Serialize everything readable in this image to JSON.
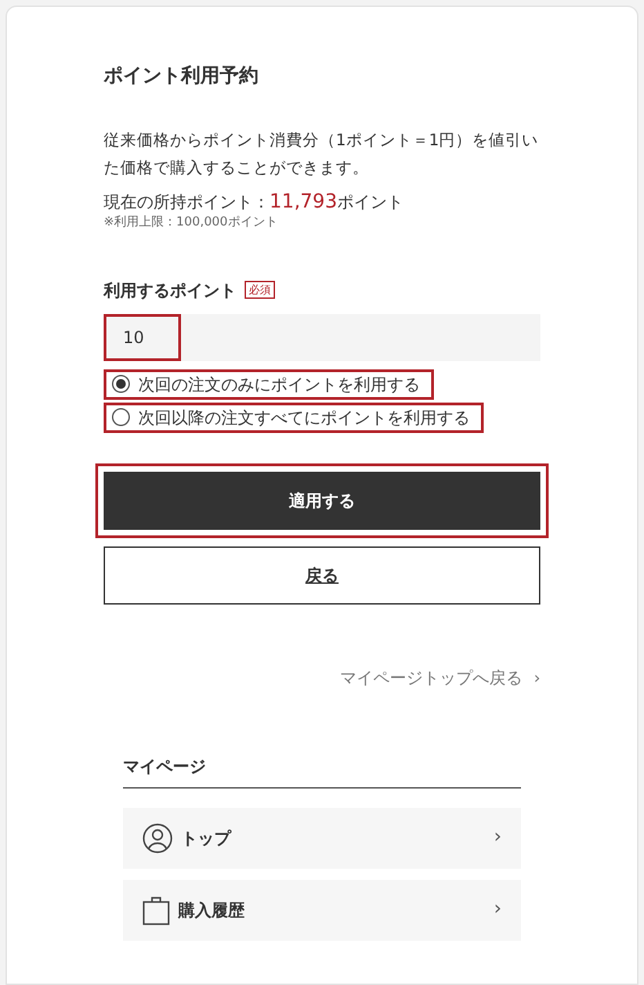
{
  "title": "ポイント利用予約",
  "description": "従来価格からポイント消費分（1ポイント＝1円）を値引いた価格で購入することができます。",
  "current_points": {
    "label": "現在の所持ポイント：",
    "value": "11,793",
    "unit": "ポイント"
  },
  "limit_note": "※利用上限：100,000ポイント",
  "points_field": {
    "label": "利用するポイント",
    "required_badge": "必須",
    "value": "10",
    "highlighted": true
  },
  "options": [
    {
      "label": "次回の注文のみにポイントを利用する",
      "selected": true,
      "highlighted": true
    },
    {
      "label": "次回以降の注文すべてにポイントを利用する",
      "selected": false,
      "highlighted": true
    }
  ],
  "apply_button": {
    "label": "適用する",
    "highlighted": true
  },
  "back_button": {
    "label": "戻る"
  },
  "mypage_link": {
    "label": "マイページトップへ戻る",
    "arrow": "›"
  },
  "mypage": {
    "heading": "マイページ",
    "items": [
      {
        "kind": "person",
        "label": "トップ",
        "arrow": "›"
      },
      {
        "kind": "bag",
        "label": "購入履歴",
        "arrow": "›"
      }
    ]
  }
}
